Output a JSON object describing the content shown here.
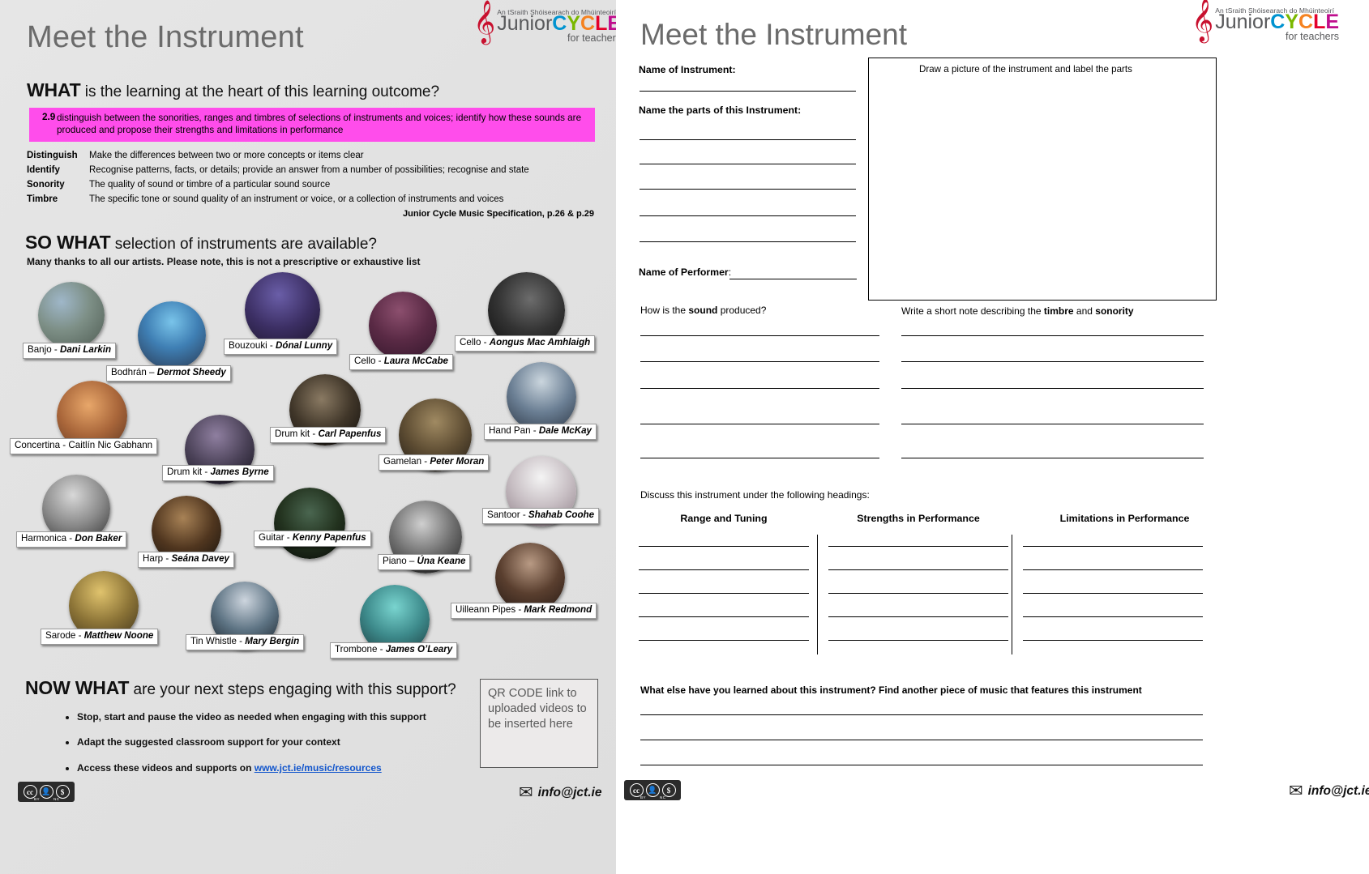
{
  "logo": {
    "tagline": "An tSraith Shóisearach do Mhúinteoirí",
    "junior": "Junior",
    "c1": "C",
    "y": "Y",
    "c2": "C",
    "l": "L",
    "e": "E",
    "subtitle": "for teachers",
    "clef": "𝄞",
    "colors": {
      "c1": "#0093d0",
      "y": "#7ab800",
      "c2": "#f58220",
      "l": "#e4002b",
      "e": "#bf0d8c",
      "junior": "#58595b"
    }
  },
  "left": {
    "title": "Meet the Instrument",
    "what": {
      "bold": "WHAT",
      "rest": " is the learning at the heart of this learning outcome?"
    },
    "outcome": {
      "number": "2.9",
      "text": "distinguish between the sonorities, ranges and timbres of selections of instruments and voices; identify how these sounds are produced and propose their strengths and limitations in performance",
      "highlight_color": "#ff4deb"
    },
    "definitions": [
      {
        "term": "Distinguish",
        "desc": "Make the differences between two or more concepts or items clear"
      },
      {
        "term": "Identify",
        "desc": "Recognise patterns, facts, or details; provide an answer from a number of possibilities; recognise and state"
      },
      {
        "term": "Sonority",
        "desc": "The quality of sound or timbre of a particular sound source"
      },
      {
        "term": "Timbre",
        "desc": "The specific tone or sound quality of an instrument or voice, or a collection of instruments and voices"
      }
    ],
    "spec_ref": "Junior Cycle Music Specification, p.26 & p.29",
    "sowhat": {
      "bold": "SO WHAT",
      "rest": " selection of instruments are available?"
    },
    "thanks": "Many thanks to all our artists. Please note, this is not a prescriptive or exhaustive list",
    "instruments": [
      {
        "instrument": "Banjo - ",
        "artist": "Dani Larkin",
        "italic": true
      },
      {
        "instrument": "Bodhrán – ",
        "artist": "Dermot Sheedy",
        "italic": true
      },
      {
        "instrument": "Bouzouki - ",
        "artist": "Dónal Lunny",
        "italic": true
      },
      {
        "instrument": "Cello - ",
        "artist": "Laura McCabe",
        "italic": true
      },
      {
        "instrument": "Cello - ",
        "artist": "Aongus Mac Amhlaigh",
        "italic": true
      },
      {
        "instrument": "Concertina - ",
        "artist": "Caitlín Nic Gabhann",
        "italic": false
      },
      {
        "instrument": "Drum kit - ",
        "artist": "Carl Papenfus",
        "italic": true
      },
      {
        "instrument": "Drum kit - ",
        "artist": "James Byrne",
        "italic": true
      },
      {
        "instrument": "Gamelan - ",
        "artist": "Peter Moran",
        "italic": true
      },
      {
        "instrument": "Hand Pan - ",
        "artist": "Dale McKay",
        "italic": true
      },
      {
        "instrument": "Harmonica - ",
        "artist": "Don Baker",
        "italic": true
      },
      {
        "instrument": "Harp - ",
        "artist": "Seána Davey",
        "italic": true
      },
      {
        "instrument": "Guitar - ",
        "artist": "Kenny Papenfus",
        "italic": true
      },
      {
        "instrument": "Piano – ",
        "artist": "Úna Keane",
        "italic": true
      },
      {
        "instrument": "Santoor - ",
        "artist": "Shahab Coohe",
        "italic": true
      },
      {
        "instrument": "Sarode - ",
        "artist": "Matthew Noone",
        "italic": true
      },
      {
        "instrument": "Tin Whistle - ",
        "artist": "Mary Bergin",
        "italic": true
      },
      {
        "instrument": "Trombone - ",
        "artist": "James O’Leary",
        "italic": true
      },
      {
        "instrument": "Uilleann Pipes - ",
        "artist": "Mark Redmond",
        "italic": true
      }
    ],
    "nowwhat": {
      "bold": "NOW WHAT",
      "rest": " are your next steps engaging with this support?"
    },
    "bullets": [
      {
        "text": "Stop, start and pause the video as needed when engaging with this support",
        "link": ""
      },
      {
        "text": "Adapt the suggested classroom support for your context",
        "link": ""
      },
      {
        "pre": "Access these videos and supports on ",
        "link": "www.jct.ie/music/resources"
      }
    ],
    "qr_note": "QR CODE link to uploaded videos to be inserted here",
    "cc_license": {
      "cc": "cc",
      "by": "BY",
      "nc": "NC"
    },
    "email": "info@jct.ie"
  },
  "right": {
    "title": "Meet the Instrument",
    "name_of_instrument": "Name of Instrument:",
    "name_parts": "Name the parts of this Instrument:",
    "name_performer_bold": "Name of Performer",
    "name_performer_rest": ":",
    "draw_caption": "Draw a picture of the instrument and label the parts",
    "sound_q": {
      "pre": "How is the ",
      "bold": "sound",
      "post": " produced?"
    },
    "timbre_q": {
      "pre": "Write a short note describing the ",
      "bold1": "timbre",
      "mid": " and ",
      "bold2": "sonority"
    },
    "discuss_heading": "Discuss this instrument under the following headings:",
    "columns": [
      "Range and Tuning",
      "Strengths in Performance",
      "Limitations in Performance"
    ],
    "final_q": "What else have you learned about this instrument? Find another piece of music that features this instrument",
    "cc_license": {
      "cc": "cc",
      "by": "BY",
      "nc": "NC"
    },
    "email": "info@jct.ie"
  }
}
